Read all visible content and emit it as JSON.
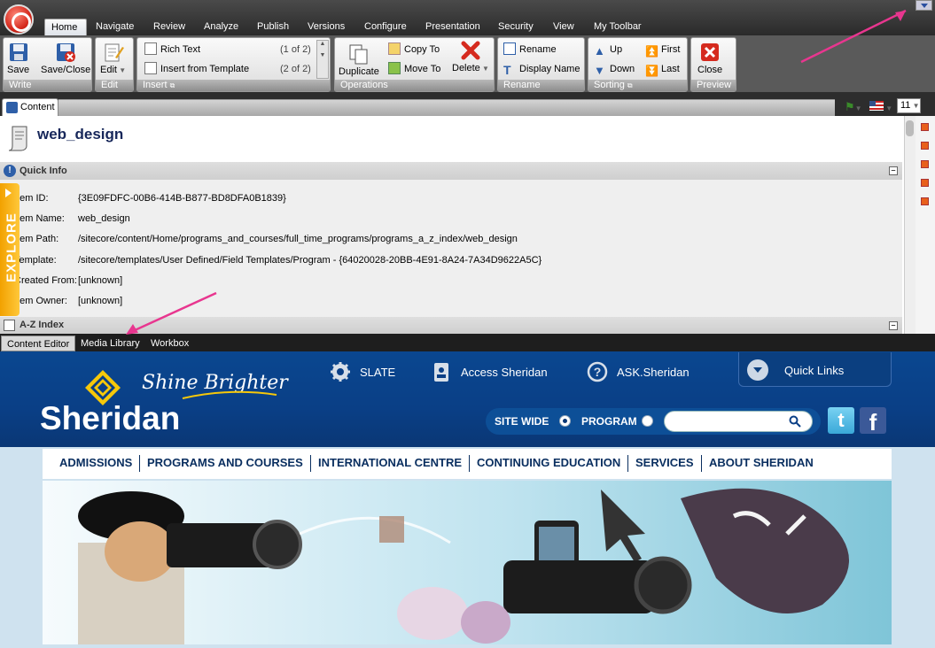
{
  "ribbon_tabs": [
    "Home",
    "Navigate",
    "Review",
    "Analyze",
    "Publish",
    "Versions",
    "Configure",
    "Presentation",
    "Security",
    "View",
    "My Toolbar"
  ],
  "groups": {
    "write": {
      "title": "Write",
      "save": "Save",
      "save_close": "Save/Close"
    },
    "edit": {
      "title": "Edit",
      "edit": "Edit"
    },
    "insert": {
      "title": "Insert",
      "rich_text": "Rich Text",
      "rich_text_count": "(1 of 2)",
      "insert_template": "Insert from Template",
      "insert_template_count": "(2 of 2)"
    },
    "operations": {
      "title": "Operations",
      "duplicate": "Duplicate",
      "copy_to": "Copy To",
      "move_to": "Move To",
      "delete": "Delete"
    },
    "rename": {
      "title": "Rename",
      "rename": "Rename",
      "display_name": "Display Name"
    },
    "sorting": {
      "title": "Sorting",
      "up": "Up",
      "down": "Down",
      "first": "First",
      "last": "Last"
    },
    "preview": {
      "title": "Preview",
      "close": "Close"
    }
  },
  "content_tab": "Content",
  "font_size_value": "11",
  "item_title": "web_design",
  "quick_info": {
    "header": "Quick Info",
    "rows": [
      {
        "label": "Item ID:",
        "value": "{3E09FDFC-00B6-414B-B877-BD8DFA0B1839}"
      },
      {
        "label": "Item Name:",
        "value": "web_design"
      },
      {
        "label": "Item Path:",
        "value": "/sitecore/content/Home/programs_and_courses/full_time_programs/programs_a_z_index/web_design"
      },
      {
        "label": "Template:",
        "value": "/sitecore/templates/User Defined/Field Templates/Program - {64020028-20BB-4E91-8A24-7A34D9622A5C}"
      },
      {
        "label": "Created From:",
        "value": "[unknown]"
      },
      {
        "label": "Item Owner:",
        "value": "[unknown]"
      }
    ]
  },
  "az_index_header": "A-Z Index",
  "explore_label": "EXPLORE",
  "app_tabs": [
    "Content Editor",
    "Media Library",
    "Workbox"
  ],
  "site": {
    "tagline": "Shine Brighter",
    "brand": "Sheridan",
    "top_links": [
      "SLATE",
      "Access Sheridan",
      "ASK.Sheridan"
    ],
    "quick_links": "Quick Links",
    "scope_site_wide": "SITE WIDE",
    "scope_program": "PROGRAM",
    "search_placeholder": "",
    "nav": [
      "ADMISSIONS",
      "PROGRAMS AND COURSES",
      "INTERNATIONAL CENTRE",
      "CONTINUING EDUCATION",
      "SERVICES",
      "ABOUT SHERIDAN"
    ]
  },
  "colors": {
    "accent_pink": "#e8368f",
    "sheridan_blue": "#0a3f86",
    "explore_orange": "#f2a100"
  }
}
